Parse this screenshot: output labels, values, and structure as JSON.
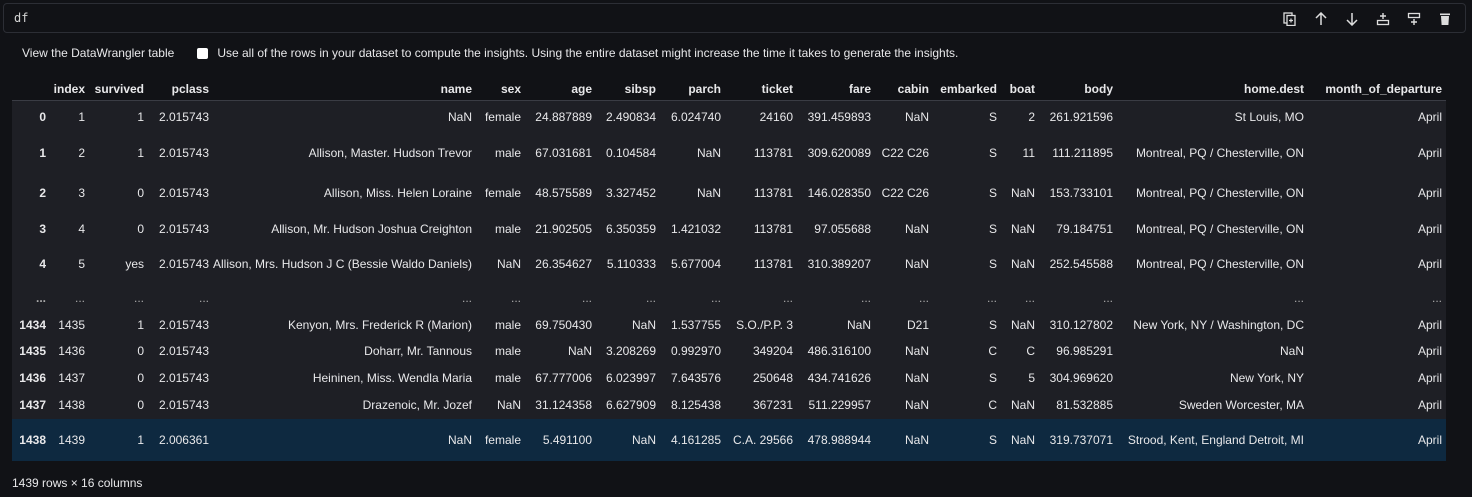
{
  "cell": {
    "code": "df",
    "toolbar": [
      {
        "name": "duplicate-icon",
        "label": "Duplicate"
      },
      {
        "name": "arrow-up-icon",
        "label": "Move up"
      },
      {
        "name": "arrow-down-icon",
        "label": "Move down"
      },
      {
        "name": "insert-above-icon",
        "label": "Insert above"
      },
      {
        "name": "insert-below-icon",
        "label": "Insert below"
      },
      {
        "name": "trash-icon",
        "label": "Delete"
      }
    ]
  },
  "options": {
    "datawrangler_link": "View the DataWrangler table",
    "use_all_rows_checked": false,
    "use_all_rows_label": "Use all of the rows in your dataset to compute the insights. Using the entire dataset might increase the time it takes to generate the insights."
  },
  "table": {
    "columns": [
      "",
      "index",
      "survived",
      "pclass",
      "name",
      "sex",
      "age",
      "sibsp",
      "parch",
      "ticket",
      "fare",
      "cabin",
      "embarked",
      "boat",
      "body",
      "home.dest",
      "month_of_departure"
    ],
    "rows": [
      [
        "0",
        "1",
        "1",
        "2.015743",
        "NaN",
        "female",
        "24.887889",
        "2.490834",
        "6.024740",
        "24160",
        "391.459893",
        "NaN",
        "S",
        "2",
        "261.921596",
        "St Louis, MO",
        "April"
      ],
      [
        "1",
        "2",
        "1",
        "2.015743",
        "Allison, Master. Hudson Trevor",
        "male",
        "67.031681",
        "0.104584",
        "NaN",
        "113781",
        "309.620089",
        "C22 C26",
        "S",
        "11",
        "111.211895",
        "Montreal, PQ / Chesterville, ON",
        "April"
      ],
      [
        "2",
        "3",
        "0",
        "2.015743",
        "Allison, Miss. Helen Loraine",
        "female",
        "48.575589",
        "3.327452",
        "NaN",
        "113781",
        "146.028350",
        "C22 C26",
        "S",
        "NaN",
        "153.733101",
        "Montreal, PQ / Chesterville, ON",
        "April"
      ],
      [
        "3",
        "4",
        "0",
        "2.015743",
        "Allison, Mr. Hudson Joshua Creighton",
        "male",
        "21.902505",
        "6.350359",
        "1.421032",
        "113781",
        "97.055688",
        "NaN",
        "S",
        "NaN",
        "79.184751",
        "Montreal, PQ / Chesterville, ON",
        "April"
      ],
      [
        "4",
        "5",
        "yes",
        "2.015743",
        "Allison, Mrs. Hudson J C (Bessie Waldo Daniels)",
        "NaN",
        "26.354627",
        "5.110333",
        "5.677004",
        "113781",
        "310.389207",
        "NaN",
        "S",
        "NaN",
        "252.545588",
        "Montreal, PQ / Chesterville, ON",
        "April"
      ],
      [
        "...",
        "...",
        "...",
        "...",
        "...",
        "...",
        "...",
        "...",
        "...",
        "...",
        "...",
        "...",
        "...",
        "...",
        "...",
        "...",
        "..."
      ],
      [
        "1434",
        "1435",
        "1",
        "2.015743",
        "Kenyon, Mrs. Frederick R (Marion)",
        "male",
        "69.750430",
        "NaN",
        "1.537755",
        "S.O./P.P. 3",
        "NaN",
        "D21",
        "S",
        "NaN",
        "310.127802",
        "New York, NY / Washington, DC",
        "April"
      ],
      [
        "1435",
        "1436",
        "0",
        "2.015743",
        "Doharr, Mr. Tannous",
        "male",
        "NaN",
        "3.208269",
        "0.992970",
        "349204",
        "486.316100",
        "NaN",
        "C",
        "C",
        "96.985291",
        "NaN",
        "April"
      ],
      [
        "1436",
        "1437",
        "0",
        "2.015743",
        "Heininen, Miss. Wendla Maria",
        "male",
        "67.777006",
        "6.023997",
        "7.643576",
        "250648",
        "434.741626",
        "NaN",
        "S",
        "5",
        "304.969620",
        "New York, NY",
        "April"
      ],
      [
        "1437",
        "1438",
        "0",
        "2.015743",
        "Drazenoic, Mr. Jozef",
        "NaN",
        "31.124358",
        "6.627909",
        "8.125438",
        "367231",
        "511.229957",
        "NaN",
        "C",
        "NaN",
        "81.532885",
        "Sweden Worcester, MA",
        "April"
      ],
      [
        "1438",
        "1439",
        "1",
        "2.006361",
        "NaN",
        "female",
        "5.491100",
        "NaN",
        "4.161285",
        "C.A. 29566",
        "478.988944",
        "NaN",
        "S",
        "NaN",
        "319.737071",
        "Strood, Kent, England Detroit, MI",
        "April"
      ]
    ]
  },
  "footer": "1439 rows × 16 columns"
}
